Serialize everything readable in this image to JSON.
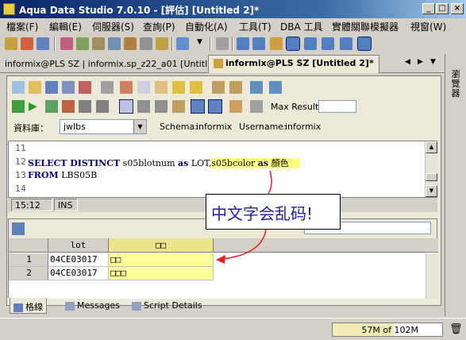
{
  "window": {
    "title": "Aqua Data Studio 7.0.10 - [評估]  [Untitled 2]*",
    "min": "_",
    "max": "□",
    "close": "×"
  },
  "menu": [
    "檔案(F)",
    "編輯(E)",
    "伺服器(S)",
    "查詢(P)",
    "自動化(A)",
    "工具(T)",
    "DBA 工具",
    "實體關聯模擬器",
    "視窗(W)"
  ],
  "side_panel": {
    "label": "瀏覽器"
  },
  "tabs": [
    {
      "label": "informix@PLS SZ | informix.sp_z22_a01 [Untitled]",
      "active": false
    },
    {
      "label": "informix@PLS SZ [Untitled 2]*",
      "active": true
    }
  ],
  "tab_nav": {
    "prev": "◀",
    "next": "▶",
    "list": "▼"
  },
  "query": {
    "max_results_label": "Max Results:",
    "max_results_value": "",
    "database_label": "資料庫：",
    "database_value": "jwlbs",
    "schema_label": "Schema:",
    "schema_value": "informix",
    "username_label": "Username:",
    "username_value": "informix"
  },
  "editor": {
    "line_numbers": [
      "11",
      "12",
      "13",
      "14"
    ],
    "line12": {
      "kw1": "SELECT DISTINCT",
      "t1": " s05blotnum ",
      "kw2": "as",
      "t2": " LOT,",
      "t3": "s05bcolor ",
      "kw3": "as",
      "t4": " 顏色"
    },
    "line13": {
      "kw1": "FROM",
      "t1": " LBS05B"
    }
  },
  "status": {
    "position": "15:12",
    "mode": "INS"
  },
  "callout": {
    "text": "中文字会乱码!"
  },
  "results": {
    "columns": [
      "lot",
      "□□"
    ],
    "rows": [
      {
        "num": "1",
        "lot": "04CE03017",
        "color": "□□"
      },
      {
        "num": "2",
        "lot": "04CE03017",
        "color": "□□□"
      }
    ]
  },
  "bottom_tabs": [
    "格線",
    "Messages",
    "Script Details"
  ],
  "memory": {
    "text": "57M of 102M",
    "used_mb": 57,
    "total_mb": 102
  },
  "colors": {
    "accent": "#0a246a",
    "highlight": "#ffff99",
    "arrow": "#e02020"
  }
}
